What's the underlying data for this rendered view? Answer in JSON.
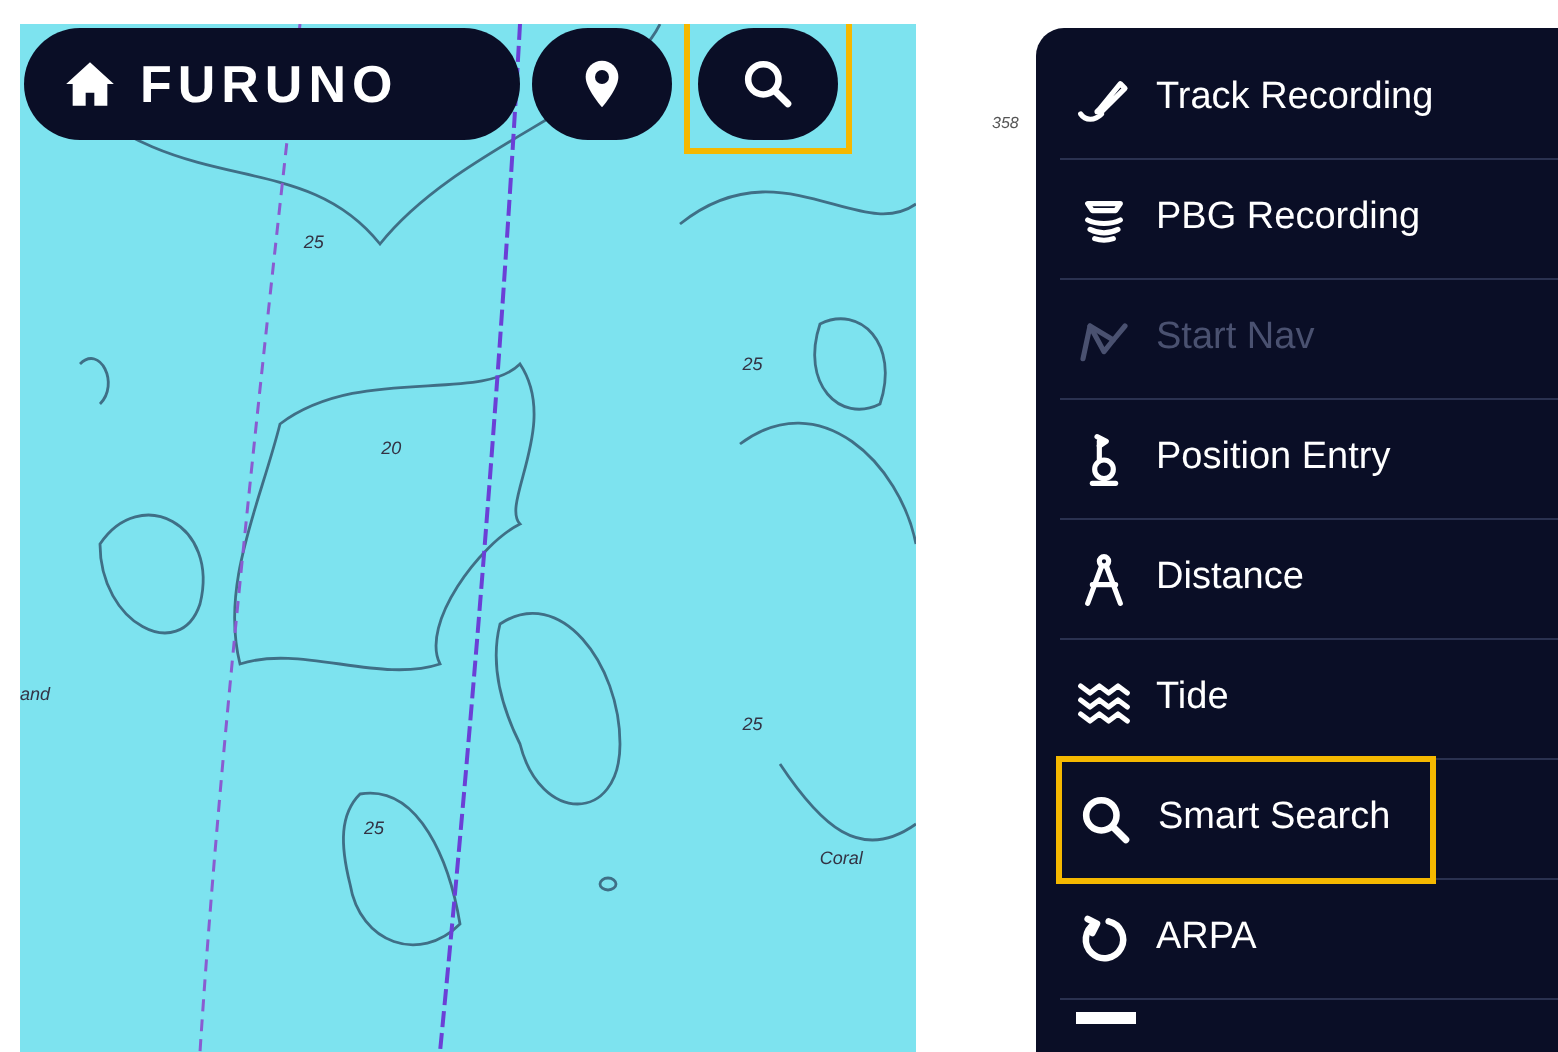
{
  "chart_app": {
    "logo_button": {
      "label": "FURUNO"
    },
    "toolbar": [
      {
        "kind": "pin",
        "highlighted": false
      },
      {
        "kind": "search",
        "highlighted": true
      }
    ],
    "depth_labels": [
      {
        "text": "25"
      },
      {
        "text": "25"
      },
      {
        "text": "20"
      },
      {
        "text": "25"
      },
      {
        "text": "25"
      },
      {
        "text": "and"
      },
      {
        "text": "Coral"
      }
    ]
  },
  "menu_app": {
    "scale_label": "358",
    "items": [
      {
        "kind": "track",
        "label": "Track Recording",
        "disabled": false,
        "highlighted": false
      },
      {
        "kind": "pbg",
        "label": "PBG Recording",
        "disabled": false,
        "highlighted": false
      },
      {
        "kind": "nav",
        "label": "Start Nav",
        "disabled": true,
        "highlighted": false
      },
      {
        "kind": "position",
        "label": "Position Entry",
        "disabled": false,
        "highlighted": false
      },
      {
        "kind": "distance",
        "label": "Distance",
        "disabled": false,
        "highlighted": false
      },
      {
        "kind": "tide",
        "label": "Tide",
        "disabled": false,
        "highlighted": false
      },
      {
        "kind": "search",
        "label": "Smart Search",
        "disabled": false,
        "highlighted": true
      },
      {
        "kind": "arpa",
        "label": "ARPA",
        "disabled": false,
        "highlighted": false
      }
    ]
  }
}
